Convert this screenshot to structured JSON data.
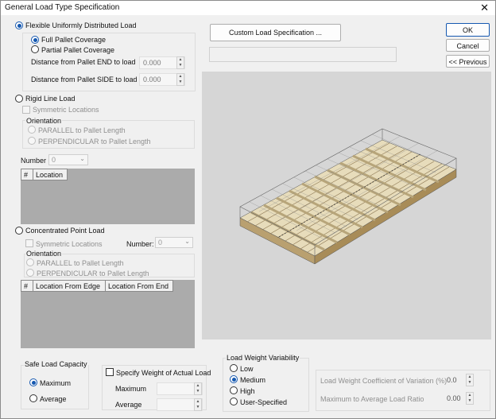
{
  "window": {
    "title": "General Load Type Specification",
    "close_glyph": "✕"
  },
  "flexible": {
    "label": "Flexible Uniformly Distributed Load",
    "full_coverage": "Full Pallet Coverage",
    "partial_coverage": "Partial Pallet Coverage",
    "dist_end_label": "Distance from Pallet END to load",
    "dist_end_value": "0.000",
    "dist_side_label": "Distance from Pallet SIDE to load",
    "dist_side_value": "0.000"
  },
  "rigid": {
    "label": "Rigid Line Load",
    "symmetric": "Symmetric Locations",
    "orientation": "Orientation",
    "parallel": "PARALLEL to Pallet Length",
    "perpendicular": "PERPENDICULAR to Pallet Length",
    "number_label": "Number",
    "number_value": "0",
    "col_hash": "#",
    "col_location": "Location"
  },
  "concentrated": {
    "label": "Concentrated Point Load",
    "symmetric": "Symmetric Locations",
    "number_label": "Number:",
    "number_value": "0",
    "orientation": "Orientation",
    "parallel": "PARALLEL to Pallet Length",
    "perpendicular": "PERPENDICULAR to Pallet Length",
    "col_hash": "#",
    "col_edge": "Location From Edge",
    "col_end": "Location From End"
  },
  "buttons": {
    "custom": "Custom Load Specification ...",
    "ok": "OK",
    "cancel": "Cancel",
    "previous": "<< Previous"
  },
  "safe_load": {
    "title": "Safe Load Capacity",
    "maximum": "Maximum",
    "average": "Average"
  },
  "specify_weight": {
    "label": "Specify Weight of Actual Load",
    "maximum": "Maximum",
    "average": "Average"
  },
  "variability": {
    "title": "Load Weight Variability",
    "options": [
      "Low",
      "Medium",
      "High",
      "User-Specified"
    ],
    "selected": "Medium"
  },
  "coefficients": {
    "cov_label": "Load Weight Coefficient of Variation (%)",
    "cov_value": "0.0",
    "ratio_label": "Maximum to Average Load Ratio",
    "ratio_value": "0.00"
  },
  "colors": {
    "accent": "#1558b0",
    "grid_bg": "#ababab",
    "wood": "#d9c79a"
  }
}
